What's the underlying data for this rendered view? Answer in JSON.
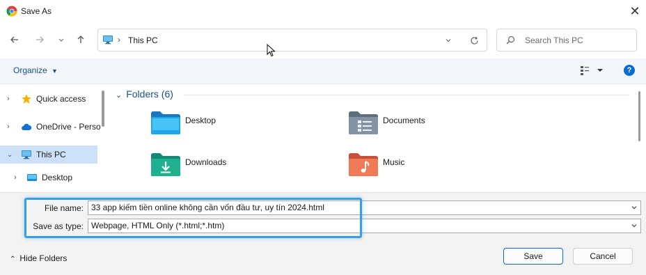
{
  "window": {
    "title": "Save As"
  },
  "address_bar": {
    "location": "This PC"
  },
  "search": {
    "placeholder": "Search This PC"
  },
  "toolbar": {
    "organize_label": "Organize",
    "help_label": "?"
  },
  "sidebar": {
    "items": [
      {
        "label": "Quick access",
        "icon": "star-icon"
      },
      {
        "label": "OneDrive - Perso",
        "icon": "cloud-icon"
      },
      {
        "label": "This PC",
        "icon": "computer-icon",
        "selected": true
      },
      {
        "label": "Desktop",
        "icon": "desktop-folder-icon"
      }
    ]
  },
  "content": {
    "group_header": "Folders (6)",
    "folders": [
      {
        "name": "Desktop",
        "icon": "desktop-folder-icon"
      },
      {
        "name": "Documents",
        "icon": "documents-folder-icon"
      },
      {
        "name": "Downloads",
        "icon": "downloads-folder-icon"
      },
      {
        "name": "Music",
        "icon": "music-folder-icon"
      }
    ]
  },
  "form": {
    "file_name_label": "File name:",
    "file_name_value": "33 app kiếm tiền online không cần vốn đầu tư, uy tín 2024.html",
    "save_type_label": "Save as type:",
    "save_type_value": "Webpage, HTML Only (*.html;*.htm)"
  },
  "footer": {
    "hide_folders_label": "Hide Folders",
    "save_label": "Save",
    "cancel_label": "Cancel"
  },
  "colors": {
    "accent": "#0a6ad2",
    "highlight": "#3a9de8",
    "selection": "#cce0f7"
  }
}
